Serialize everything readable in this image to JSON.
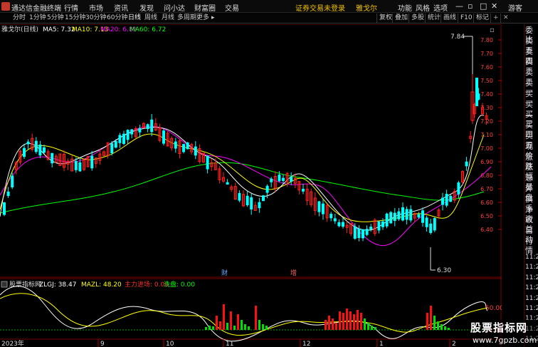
{
  "titlebar": {
    "app_name": "通达信金融终端",
    "menus": [
      "行情",
      "市场",
      "资讯",
      "发现",
      "问小达",
      "财富圈",
      "交易"
    ],
    "notice": "证券交易未登录",
    "stock_name": "雅戈尔",
    "tools": [
      "功能",
      "风格",
      "选项"
    ],
    "guest": "游客"
  },
  "periodbar": {
    "tabs": [
      "分时",
      "1分钟",
      "5分钟",
      "15分钟",
      "30分钟",
      "60分钟",
      "日线",
      "周线",
      "月线",
      "多周期",
      "更多"
    ],
    "active_tab": "日线",
    "right_tools": [
      "复权",
      "叠加",
      "多股",
      "统计",
      "画线",
      "F10",
      "标记"
    ]
  },
  "main_panel": {
    "title": "雅戈尔(日线)",
    "ma_labels": [
      {
        "text": "MA5: 7.32",
        "color": "#ffffff"
      },
      {
        "text": "MA10: 7.13",
        "color": "#ffff00"
      },
      {
        "text": "MA20: 6.89",
        "color": "#ff00ff"
      },
      {
        "text": "MA60: 6.72",
        "color": "#00ff00"
      }
    ],
    "price_ticks": [
      "7.80",
      "7.70",
      "7.60",
      "7.50",
      "7.40",
      "7.30",
      "7.20",
      "7.10",
      "7.00",
      "6.90",
      "6.80",
      "6.70",
      "6.60",
      "6.50",
      "6.40"
    ],
    "high_marker": "7.84",
    "low_marker": "6.30",
    "event_markers": [
      "财",
      "增"
    ],
    "up_color": "#00ffff",
    "down_color": "#ff2020"
  },
  "indicator_panel": {
    "name": "股票指标网",
    "labels": [
      {
        "text": "ZLGJ: 38.47",
        "color": "#ffffff"
      },
      {
        "text": "MAZL: 48.20",
        "color": "#ffff00"
      },
      {
        "text": "主力进场: 0.00",
        "color": "#ff3030"
      },
      {
        "text": "洗盘: 0.00",
        "color": "#00ff00"
      }
    ],
    "ticks": [
      "50.00",
      "0.00"
    ]
  },
  "xaxis": {
    "labels": [
      "2023年",
      "9",
      "10",
      "11",
      "12",
      "1",
      "2"
    ]
  },
  "right_panel": {
    "items": [
      "委比",
      "卖五",
      "卖四",
      "卖三",
      "卖二",
      "卖一",
      "买一",
      "买二",
      "买三",
      "买四",
      "买五",
      "现价",
      "涨跌",
      "涨幅",
      "总量",
      "外盘",
      "换手",
      "净资",
      "收益",
      "自动",
      "行情"
    ],
    "times": [
      "11:29",
      "11:29",
      "11:29",
      "11:29",
      "11:29",
      "11:29",
      "11:29",
      "11:29",
      "11:29"
    ]
  },
  "watermark": {
    "title": "股票指标网",
    "url": "www.7gpzb.com"
  }
}
